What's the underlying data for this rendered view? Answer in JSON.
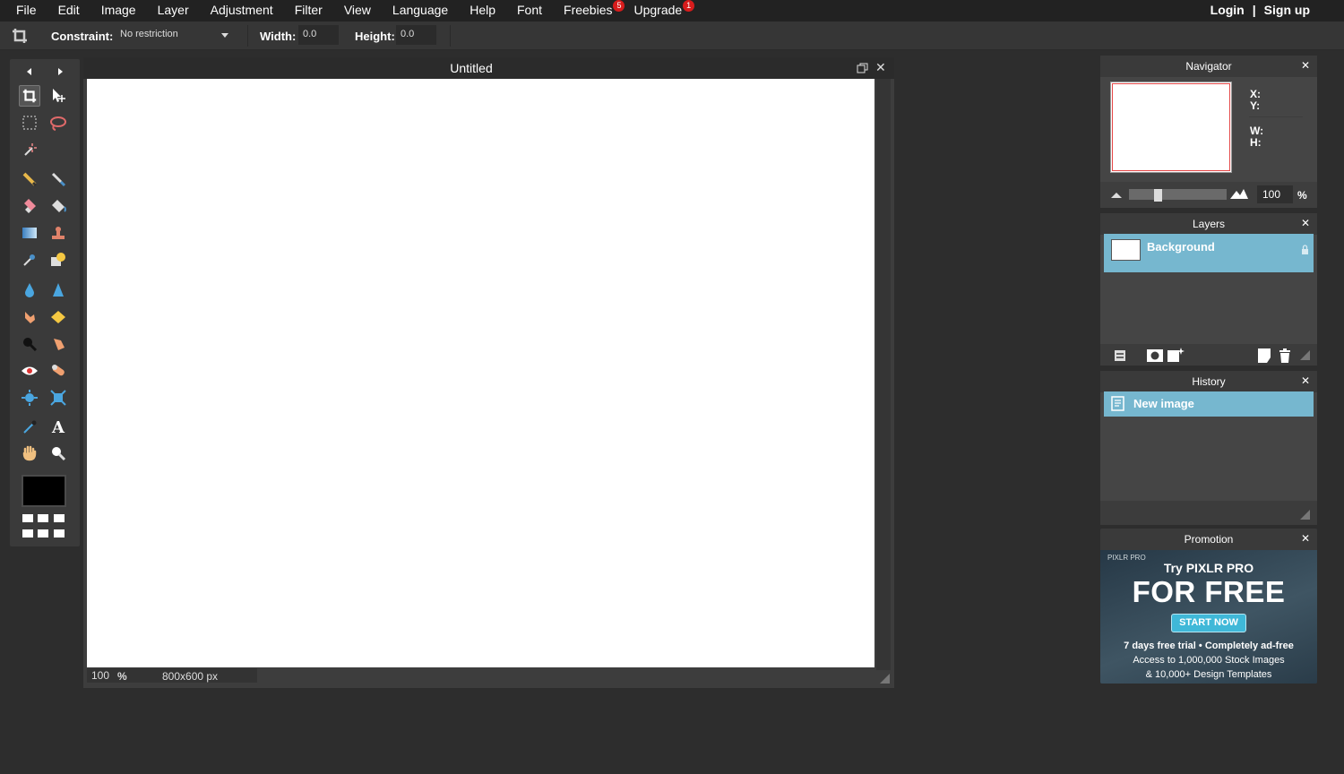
{
  "menu": {
    "items": [
      {
        "label": "File"
      },
      {
        "label": "Edit"
      },
      {
        "label": "Image"
      },
      {
        "label": "Layer"
      },
      {
        "label": "Adjustment"
      },
      {
        "label": "Filter"
      },
      {
        "label": "View"
      },
      {
        "label": "Language"
      },
      {
        "label": "Help"
      },
      {
        "label": "Font"
      },
      {
        "label": "Freebies",
        "badge": "5"
      },
      {
        "label": "Upgrade",
        "badge": "1"
      }
    ],
    "login": "Login",
    "separator": "|",
    "signup": "Sign up"
  },
  "options": {
    "constraint_label": "Constraint:",
    "constraint_value": "No restriction",
    "width_label": "Width:",
    "width_value": "0.0",
    "height_label": "Height:",
    "height_value": "0.0"
  },
  "toolbox": {
    "tools": [
      "crop-icon",
      "move-icon",
      "marquee-icon",
      "lasso-icon",
      "wand-icon",
      "pencil-icon",
      "brush-icon",
      "eraser-icon",
      "bucket-icon",
      "gradient-icon",
      "stamp-icon",
      "picker-icon",
      "replace-icon",
      "drop-icon",
      "sharpen-icon",
      "smudge-icon",
      "sponge-icon",
      "burn-icon",
      "dodge-icon",
      "redeye-icon",
      "spot-heal-icon",
      "bloat-icon",
      "pinch-icon",
      "colorpicker-icon",
      "text-icon",
      "hand-icon",
      "zoom-icon"
    ],
    "foreground_color": "#000000"
  },
  "document": {
    "title": "Untitled",
    "zoom": "100",
    "zoom_unit": "%",
    "size": "800x600 px"
  },
  "navigator": {
    "title": "Navigator",
    "x_label": "X:",
    "y_label": "Y:",
    "w_label": "W:",
    "h_label": "H:",
    "zoom_value": "100",
    "zoom_unit": "%"
  },
  "layers": {
    "title": "Layers",
    "items": [
      {
        "name": "Background",
        "locked": true
      }
    ]
  },
  "history": {
    "title": "History",
    "items": [
      {
        "name": "New image"
      }
    ]
  },
  "promotion": {
    "title": "Promotion",
    "brand": "PIXLR PRO",
    "line1": "Try PIXLR PRO",
    "line2": "FOR FREE",
    "cta": "START NOW",
    "text1": "7 days free trial • Completely ad-free",
    "text2": "Access to 1,000,000 Stock Images",
    "text3": "& 10,000+ Design Templates"
  },
  "colors": {
    "accent": "#76b7cf",
    "badge": "#d71c1c"
  }
}
